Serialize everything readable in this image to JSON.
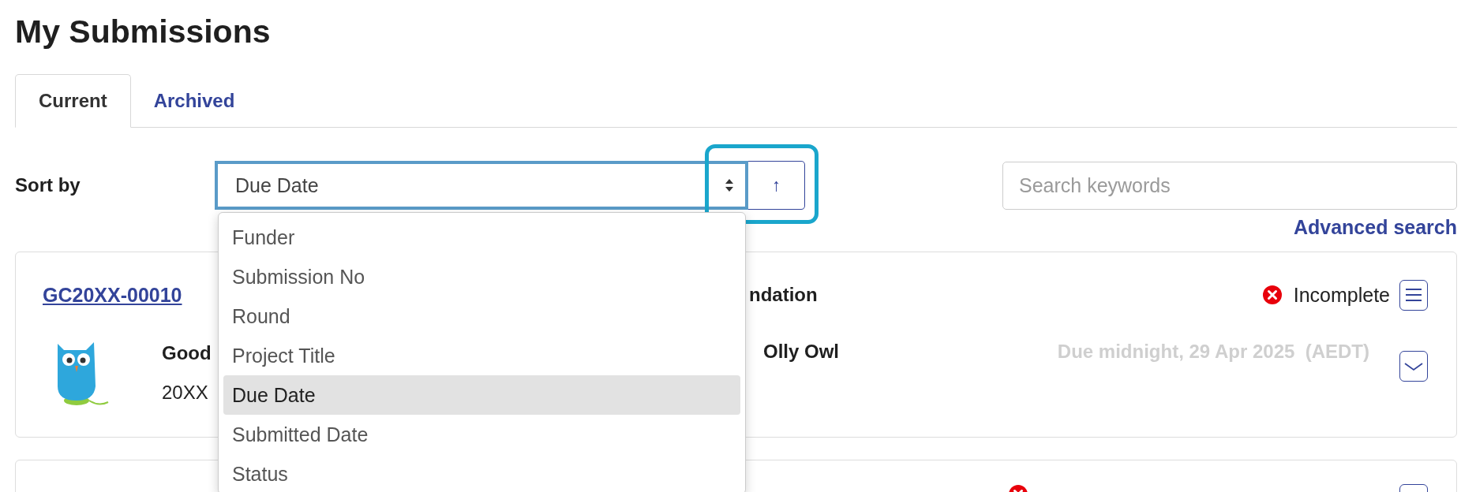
{
  "page_title": "My Submissions",
  "tabs": [
    {
      "label": "Current",
      "selected": true
    },
    {
      "label": "Archived",
      "selected": false
    }
  ],
  "sort": {
    "label": "Sort by",
    "value": "Due Date",
    "direction_button": "↑",
    "options": [
      {
        "label": "Funder",
        "selected": false
      },
      {
        "label": "Submission No",
        "selected": false
      },
      {
        "label": "Round",
        "selected": false
      },
      {
        "label": "Project Title",
        "selected": false
      },
      {
        "label": "Due Date",
        "selected": true
      },
      {
        "label": "Submitted Date",
        "selected": false
      },
      {
        "label": "Status",
        "selected": false
      }
    ]
  },
  "search": {
    "placeholder": "Search keywords",
    "advanced_link": "Advanced search"
  },
  "submissions": [
    {
      "kind": "full",
      "number": "GC20XX-00010",
      "funder": "ndation",
      "title": "Good",
      "round": "20XX",
      "applicant": "Olly Owl",
      "due": "Due midnight, 29 Apr 2025  (AEDT)",
      "status": {
        "text": "Incomplete",
        "kind": "error"
      }
    },
    {
      "kind": "partial",
      "status": {
        "kind": "error"
      }
    }
  ]
}
